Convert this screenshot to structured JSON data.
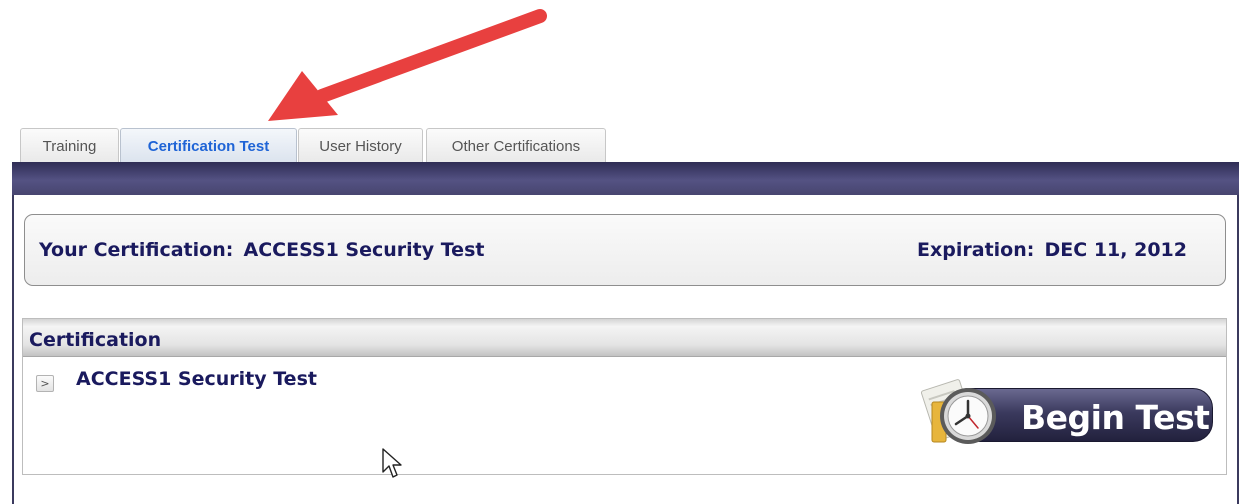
{
  "tabs": [
    {
      "label": "Training",
      "active": false
    },
    {
      "label": "Certification Test",
      "active": true
    },
    {
      "label": "User History",
      "active": false
    },
    {
      "label": "Other Certifications",
      "active": false
    }
  ],
  "certification_info": {
    "certification_label": "Your Certification:",
    "certification_value": "ACCESS1 Security Test",
    "expiration_label": "Expiration:",
    "expiration_value": "DEC 11, 2012"
  },
  "certification_section": {
    "header": "Certification",
    "expand_glyph": ">",
    "item_name": "ACCESS1 Security Test",
    "begin_test_label": "Begin Test"
  },
  "icons": {
    "annotation": "red-arrow-icon",
    "begin_test": "clock-document-icon",
    "pointer": "mouse-cursor-icon"
  },
  "colors": {
    "annotation_arrow": "#e8403f",
    "active_tab_text": "#1f64d6",
    "header_bar": "#3b3a5e",
    "heading_text": "#1a1a5e"
  }
}
